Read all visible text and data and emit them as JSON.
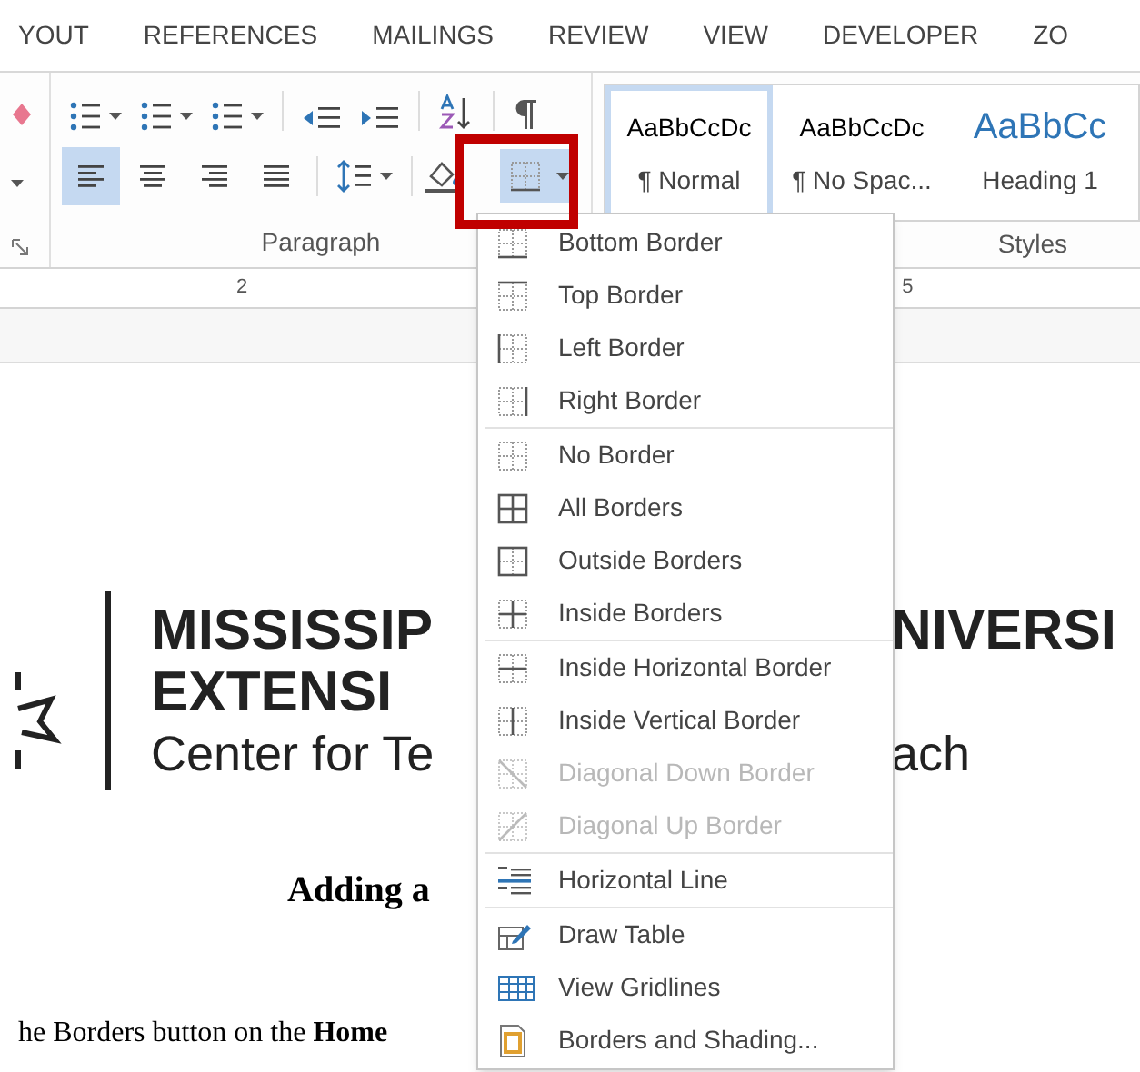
{
  "ribbon_tabs": [
    {
      "label": "YOUT"
    },
    {
      "label": "REFERENCES"
    },
    {
      "label": "MAILINGS"
    },
    {
      "label": "REVIEW"
    },
    {
      "label": "VIEW"
    },
    {
      "label": "DEVELOPER"
    },
    {
      "label": "ZO"
    }
  ],
  "paragraph_group": {
    "label": "Paragraph",
    "alignment": [
      {
        "kind": "left",
        "selected": true
      },
      {
        "kind": "center",
        "selected": false
      },
      {
        "kind": "right",
        "selected": false
      },
      {
        "kind": "justify",
        "selected": false
      }
    ],
    "borders_button": {
      "selected": true
    }
  },
  "styles_group": {
    "label": "Styles",
    "styles": [
      {
        "sample": "AaBbCcDc",
        "name": "¶ Normal",
        "kind": "normal",
        "selected": true
      },
      {
        "sample": "AaBbCcDc",
        "name": "¶ No Spac...",
        "kind": "normal",
        "selected": false
      },
      {
        "sample": "AaBbCc",
        "name": "Heading 1",
        "kind": "heading",
        "selected": false
      }
    ]
  },
  "ruler": {
    "labels": [
      "2",
      "5"
    ]
  },
  "document": {
    "logo": {
      "left_lines": [
        "MISSISSIP",
        "EXTENSI",
        "Center for Te"
      ],
      "right_lines": [
        "NIVERSI",
        "ach"
      ]
    },
    "heading": "Adding a",
    "body": "he Borders button on the **Home**"
  },
  "borders_menu": {
    "sections": [
      [
        {
          "label": "Bottom Border",
          "kind": "bottom",
          "disabled": false
        },
        {
          "label": "Top Border",
          "kind": "top",
          "disabled": false
        },
        {
          "label": "Left Border",
          "kind": "left",
          "disabled": false
        },
        {
          "label": "Right Border",
          "kind": "right",
          "disabled": false
        }
      ],
      [
        {
          "label": "No Border",
          "kind": "none",
          "disabled": false
        },
        {
          "label": "All Borders",
          "kind": "all",
          "disabled": false
        },
        {
          "label": "Outside Borders",
          "kind": "outside",
          "disabled": false
        },
        {
          "label": "Inside Borders",
          "kind": "inside",
          "disabled": false
        }
      ],
      [
        {
          "label": "Inside Horizontal Border",
          "kind": "insideh",
          "disabled": false
        },
        {
          "label": "Inside Vertical Border",
          "kind": "insidev",
          "disabled": false
        },
        {
          "label": "Diagonal Down Border",
          "kind": "diagdown",
          "disabled": true
        },
        {
          "label": "Diagonal Up Border",
          "kind": "diagup",
          "disabled": true
        }
      ],
      [
        {
          "label": "Horizontal Line",
          "kind": "hline",
          "disabled": false
        }
      ],
      [
        {
          "label": "Draw Table",
          "kind": "table",
          "disabled": false
        },
        {
          "label": "View Gridlines",
          "kind": "gridlines",
          "disabled": false
        },
        {
          "label": "Borders and Shading...",
          "kind": "shading",
          "disabled": false
        }
      ]
    ]
  }
}
